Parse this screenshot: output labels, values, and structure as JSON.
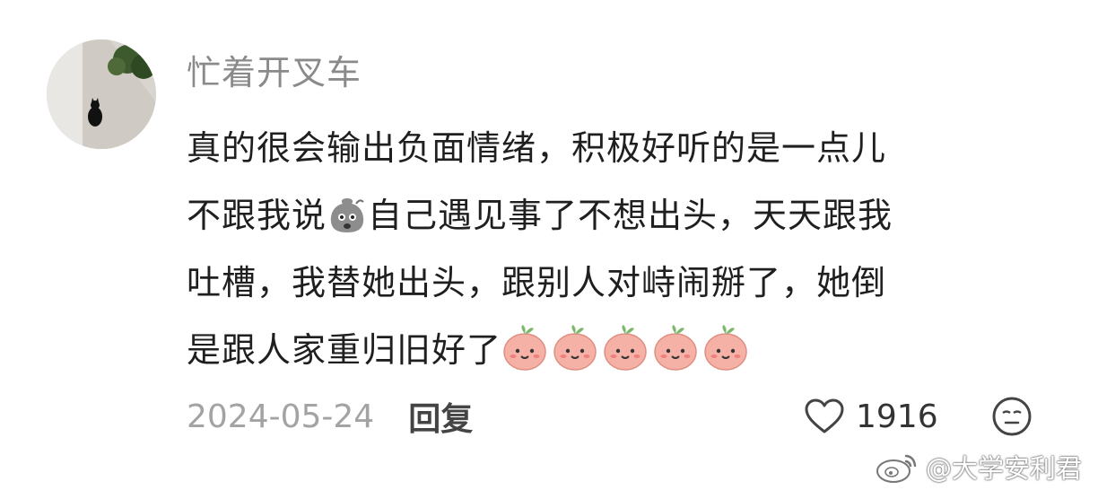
{
  "comment": {
    "username": "忙着开叉车",
    "lines": [
      "真的很会输出负面情绪，积极好听的是一点儿",
      "不跟我说",
      "自己遇见事了不想出头，天天跟我",
      "吐槽，我替她出头，跟别人对峙闹掰了，她倒",
      "是跟人家重归旧好了"
    ],
    "date": "2024-05-24",
    "reply_label": "回复",
    "like_count": "1916"
  },
  "icons": {
    "avatar": "black-cat-photo",
    "inline_emoji": "sweat-bag-emoji",
    "trailing_emojis": [
      "peach-smile-emoji",
      "peach-smile-emoji",
      "peach-smile-emoji",
      "peach-smile-emoji",
      "peach-smile-emoji"
    ],
    "like": "heart-outline-icon",
    "more": "meh-face-icon",
    "watermark_logo": "weibo-logo-icon"
  },
  "watermark": {
    "text": "@大学安利君"
  },
  "colors": {
    "username": "#8a8a8a",
    "text": "#1f1f1f",
    "date": "#a3a3a3",
    "peach": "#f4a9a0"
  }
}
